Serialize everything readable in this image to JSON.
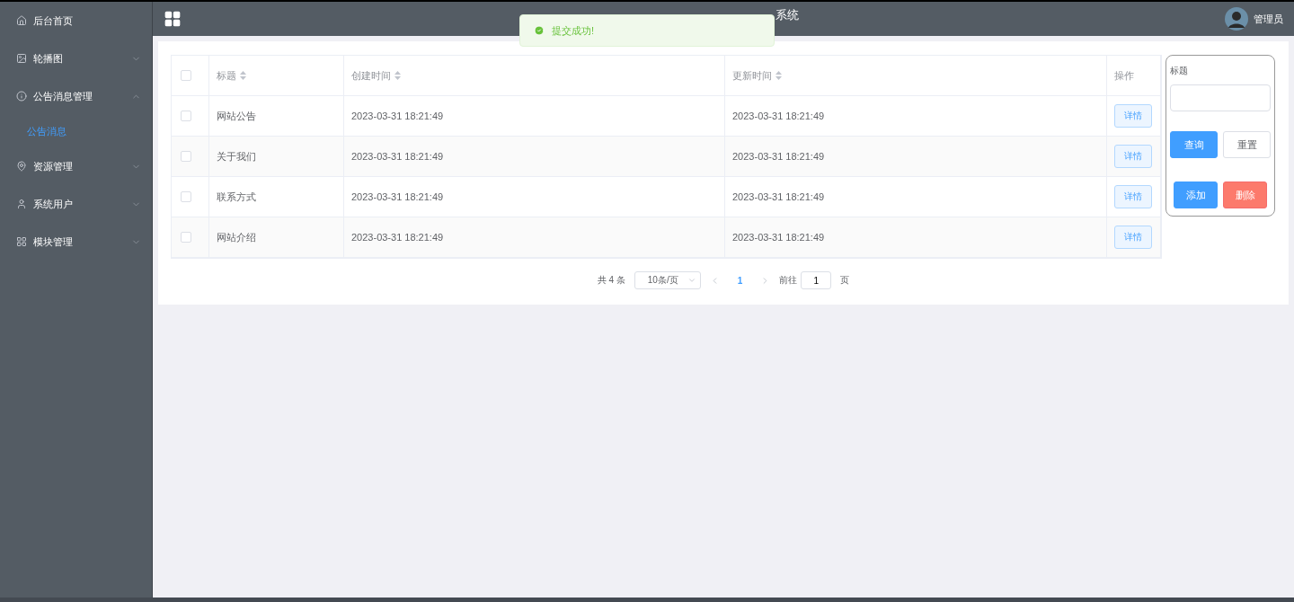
{
  "sidebar": {
    "items": [
      {
        "label": "后台首页"
      },
      {
        "label": "轮播图",
        "expanded": false
      },
      {
        "label": "公告消息管理",
        "expanded": true,
        "children": [
          {
            "label": "公告消息",
            "selected": true
          }
        ]
      },
      {
        "label": "资源管理",
        "expanded": false
      },
      {
        "label": "系统用户",
        "expanded": false
      },
      {
        "label": "模块管理",
        "expanded": false
      }
    ]
  },
  "header": {
    "title": "系统",
    "user": "管理员"
  },
  "toast": {
    "message": "提交成功!"
  },
  "table": {
    "select_all_checked": false,
    "columns": [
      {
        "label": "标题",
        "sortable": true
      },
      {
        "label": "创建时间",
        "sortable": true
      },
      {
        "label": "更新时间",
        "sortable": true
      },
      {
        "label": "操作",
        "sortable": false
      }
    ],
    "rows": [
      {
        "checked": false,
        "title": "网站公告",
        "created": "2023-03-31 18:21:49",
        "updated": "2023-03-31 18:21:49",
        "action": "详情"
      },
      {
        "checked": false,
        "title": "关于我们",
        "created": "2023-03-31 18:21:49",
        "updated": "2023-03-31 18:21:49",
        "action": "详情"
      },
      {
        "checked": false,
        "title": "联系方式",
        "created": "2023-03-31 18:21:49",
        "updated": "2023-03-31 18:21:49",
        "action": "详情"
      },
      {
        "checked": false,
        "title": "网站介绍",
        "created": "2023-03-31 18:21:49",
        "updated": "2023-03-31 18:21:49",
        "action": "详情"
      }
    ]
  },
  "pagination": {
    "total": "共 4 条",
    "page_size": "10条/页",
    "pages": [
      {
        "label": "1",
        "selected": true
      }
    ],
    "goto_label": "前往",
    "goto_value": "1",
    "goto_suffix": "页"
  },
  "search_panel": {
    "field_label": "标题",
    "buttons": [
      {
        "label": "查询",
        "kind": "primary"
      },
      {
        "label": "重置",
        "kind": "plain"
      },
      {
        "label": "添加",
        "kind": "primary"
      },
      {
        "label": "删除",
        "kind": "danger"
      }
    ]
  }
}
